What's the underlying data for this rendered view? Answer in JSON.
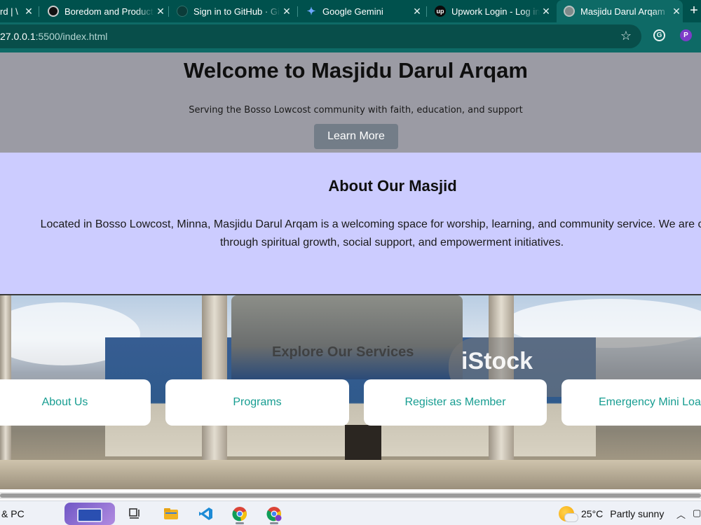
{
  "browser": {
    "tabs": [
      {
        "title": "rd | \\",
        "icon": "page-icon",
        "color": "#5f6368",
        "active": false
      },
      {
        "title": "Boredom and Productivity",
        "icon": "chatgpt-icon",
        "color": "#1a1a1a",
        "active": false
      },
      {
        "title": "Sign in to GitHub · GitHub",
        "icon": "github-icon",
        "color": "#1a1a1a",
        "active": false
      },
      {
        "title": "Google Gemini",
        "icon": "gemini-sparkle-icon",
        "color": "#4f8cf7",
        "active": false
      },
      {
        "title": "Upwork Login - Log in",
        "icon": "upwork-icon",
        "color": "#0b0b0b",
        "active": false
      },
      {
        "title": "Masjidu Darul Arqam",
        "icon": "globe-icon",
        "color": "#9aa0a6",
        "active": true
      }
    ],
    "url_host": "27.0.0.1",
    "url_rest": ":5500/index.html",
    "chrome_color": "#0e6a66",
    "tabbar_color": "#00514d"
  },
  "hero": {
    "title": "Welcome to Masjidu Darul Arqam",
    "subtitle": "Serving the Bosso Lowcost community with faith, education, and support",
    "button": "Learn More",
    "bg": "#9b9ba4"
  },
  "about": {
    "heading": "About Our Masjid",
    "line1": "Located in Bosso Lowcost, Minna, Masjidu Darul Arqam is a welcoming space for worship, learning, and community service. We are committe",
    "line2": "through spiritual growth, social support, and empowerment initiatives.",
    "bg": "#ccccff"
  },
  "services": {
    "heading": "Explore Our Services",
    "watermark": "iStock",
    "buttons": [
      "About Us",
      "Programs",
      "Register as Member",
      "Emergency Mini Loa"
    ],
    "button_text_color": "#179d91"
  },
  "taskbar": {
    "left_text": "& PC",
    "weather_temp": "25°C",
    "weather_desc": "Partly sunny",
    "apps": [
      "widgets-icon",
      "task-view-icon",
      "file-explorer-icon",
      "vscode-icon",
      "chrome-icon",
      "chrome-profile-icon"
    ]
  }
}
